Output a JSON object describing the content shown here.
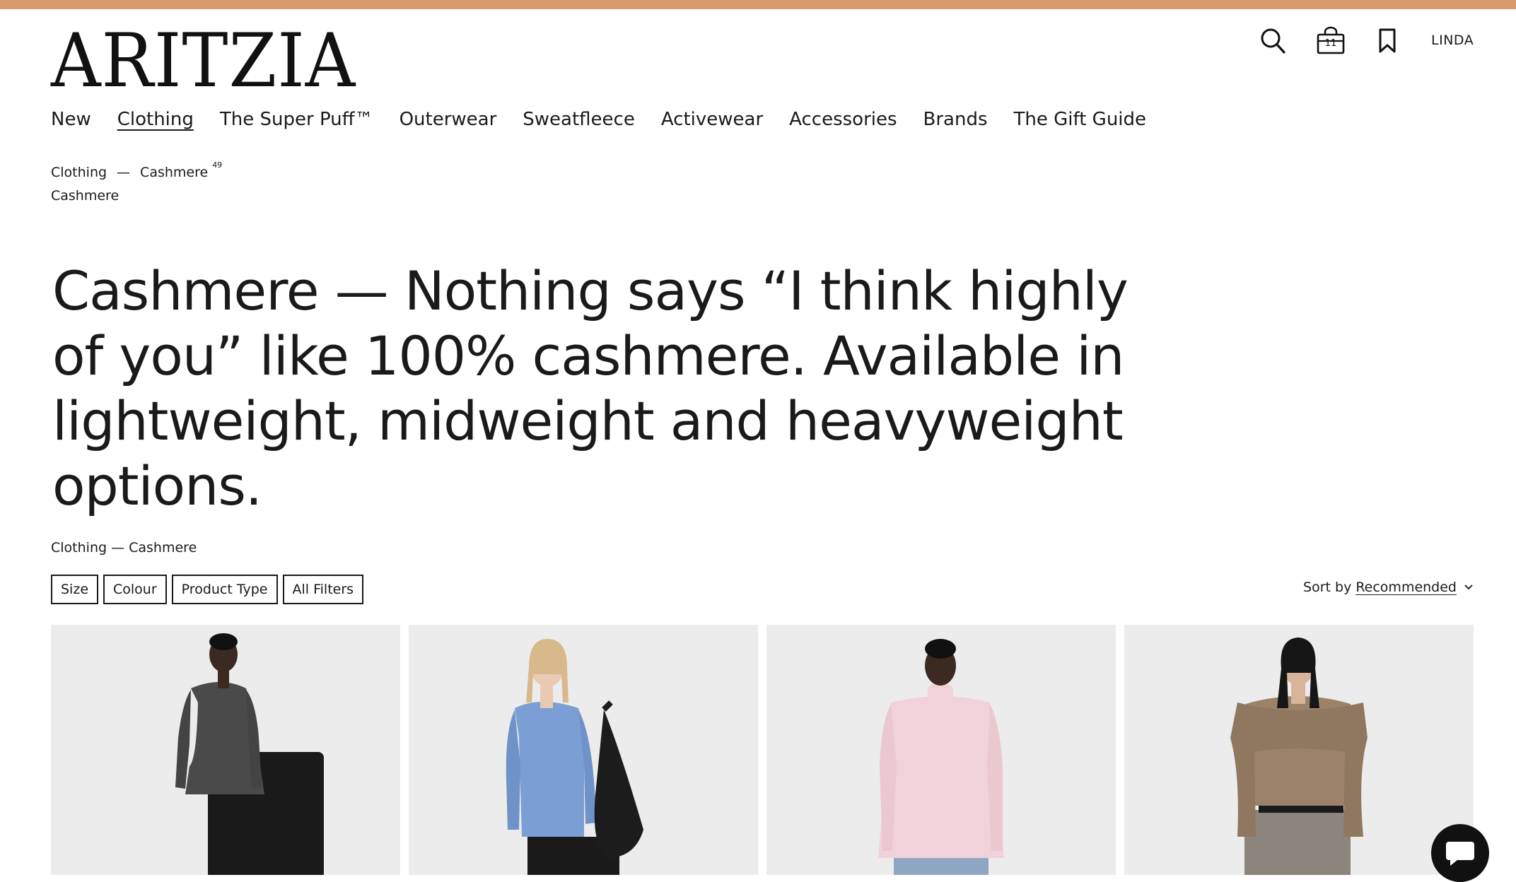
{
  "brand": {
    "logo_text": "ARITZIA",
    "accent_color": "#d99b6b"
  },
  "utility": {
    "search_icon": "search-icon",
    "bag_icon": "shopping-bag-icon",
    "bag_count": "11",
    "wishlist_icon": "bookmark-icon",
    "user_label": "LINDA"
  },
  "nav": {
    "items": [
      "New",
      "Clothing",
      "The Super Puff™",
      "Outerwear",
      "Sweatfleece",
      "Activewear",
      "Accessories",
      "Brands",
      "The Gift Guide"
    ],
    "active": "Clothing"
  },
  "breadcrumb": {
    "parent": "Clothing",
    "separator": "—",
    "current": "Cashmere",
    "count": "49",
    "sub": "Cashmere"
  },
  "headline": "Cashmere — Nothing says “I think highly of you” like 100% cashmere. Available in lightweight, midweight and heavyweight options.",
  "breadcrumb2": "Clothing — Cashmere",
  "filters": [
    "Size",
    "Colour",
    "Product Type",
    "All Filters"
  ],
  "sort": {
    "label": "Sort by",
    "value": "Recommended"
  },
  "products": [
    {
      "image": "model-charcoal-cardigan",
      "garment_color": "#4a4a4a"
    },
    {
      "image": "model-blue-sweater",
      "garment_color": "#7b9fd4"
    },
    {
      "image": "model-pink-turtleneck",
      "garment_color": "#f1d2da"
    },
    {
      "image": "model-brown-scarf-sweater",
      "garment_color": "#9c8269"
    }
  ],
  "chat_icon": "chat-icon"
}
